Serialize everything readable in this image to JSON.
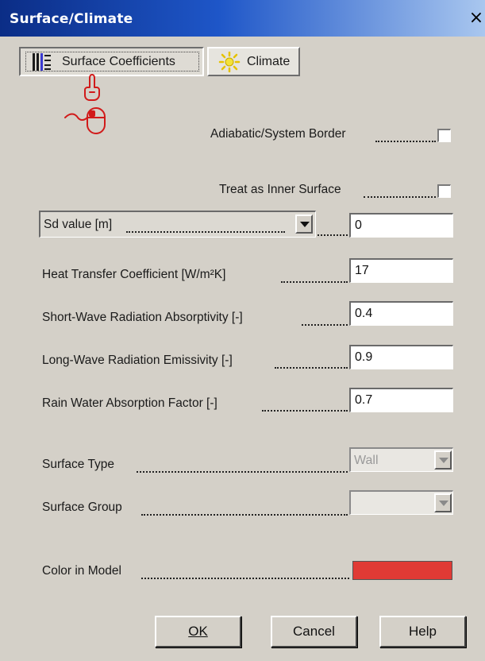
{
  "window": {
    "title": "Surface/Climate",
    "close_glyph": "×"
  },
  "tabs": [
    {
      "label": "Surface Coefficients",
      "icon": "surface-layers-icon",
      "active": true
    },
    {
      "label": "Climate",
      "icon": "sun-icon",
      "active": false
    }
  ],
  "checkboxes": {
    "adiabatic": {
      "label": "Adiabatic/System Border",
      "checked": false
    },
    "inner_surface": {
      "label": "Treat as Inner Surface",
      "checked": false
    }
  },
  "sd_select": {
    "label": "Sd value [m]",
    "value": "0"
  },
  "fields": [
    {
      "label": "Heat Transfer Coefficient [W/m²K]",
      "value": "17"
    },
    {
      "label": "Short-Wave Radiation Absorptivity [-]",
      "value": "0.4"
    },
    {
      "label": "Long-Wave Radiation Emissivity [-]",
      "value": "0.9"
    },
    {
      "label": "Rain Water Absorption Factor [-]",
      "value": "0.7"
    }
  ],
  "surface_type": {
    "label": "Surface Type",
    "value": "Wall"
  },
  "surface_group": {
    "label": "Surface Group",
    "value": ""
  },
  "color_in_model": {
    "label": "Color in Model",
    "color": "#e03a35"
  },
  "buttons": {
    "ok": "OK",
    "cancel": "Cancel",
    "help": "Help"
  },
  "colors": {
    "title_start": "#0b2d86",
    "title_end": "#a9c7ef",
    "face": "#d4d0c8",
    "pointer_red": "#d11a1a"
  }
}
